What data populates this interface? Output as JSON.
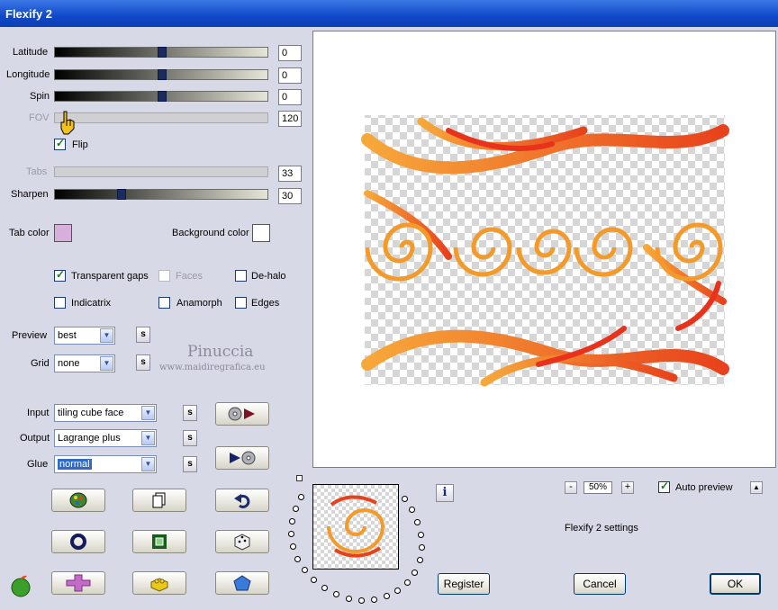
{
  "window": {
    "title": "Flexify 2"
  },
  "sliders": [
    {
      "label": "Latitude",
      "value": "0",
      "position": 0.5,
      "enabled": true
    },
    {
      "label": "Longitude",
      "value": "0",
      "position": 0.5,
      "enabled": true
    },
    {
      "label": "Spin",
      "value": "0",
      "position": 0.5,
      "enabled": true
    },
    {
      "label": "FOV",
      "value": "120",
      "position": 0.0,
      "enabled": false
    },
    {
      "label": "Tabs",
      "value": "33",
      "position": 0.0,
      "enabled": false
    },
    {
      "label": "Sharpen",
      "value": "30",
      "position": 0.3,
      "enabled": true
    }
  ],
  "flip": {
    "label": "Flip",
    "checked": true
  },
  "colors": {
    "tab_label": "Tab color",
    "tab_value": "#d8aedc",
    "bg_label": "Background color",
    "bg_value": "#ffffff"
  },
  "options": {
    "transparent_gaps": {
      "label": "Transparent gaps",
      "checked": true
    },
    "faces": {
      "label": "Faces",
      "checked": false,
      "enabled": false
    },
    "de_halo": {
      "label": "De-halo",
      "checked": false
    },
    "indicatrix": {
      "label": "Indicatrix",
      "checked": false
    },
    "anamorph": {
      "label": "Anamorph",
      "checked": false
    },
    "edges": {
      "label": "Edges",
      "checked": false
    }
  },
  "preview_select": {
    "label": "Preview",
    "value": "best"
  },
  "grid_select": {
    "label": "Grid",
    "value": "none"
  },
  "watermark": {
    "name": "Pinuccia",
    "url": "www.maidiregrafica.eu"
  },
  "input_select": {
    "label": "Input",
    "value": "tiling cube face"
  },
  "output_select": {
    "label": "Output",
    "value": "Lagrange plus"
  },
  "glue_select": {
    "label": "Glue",
    "value": "normal"
  },
  "s_label": "s",
  "zoom": {
    "value": "50%",
    "minus": "-",
    "plus": "+"
  },
  "auto_preview": {
    "label": "Auto preview",
    "checked": true
  },
  "up_label": "▲",
  "settings_text": "Flexify 2 settings",
  "buttons": {
    "register": "Register",
    "cancel": "Cancel",
    "ok": "OK"
  },
  "info_label": "i",
  "accent": {
    "orange": "#f39a2a",
    "red": "#e8321c",
    "titlebar": "#1148c8"
  }
}
